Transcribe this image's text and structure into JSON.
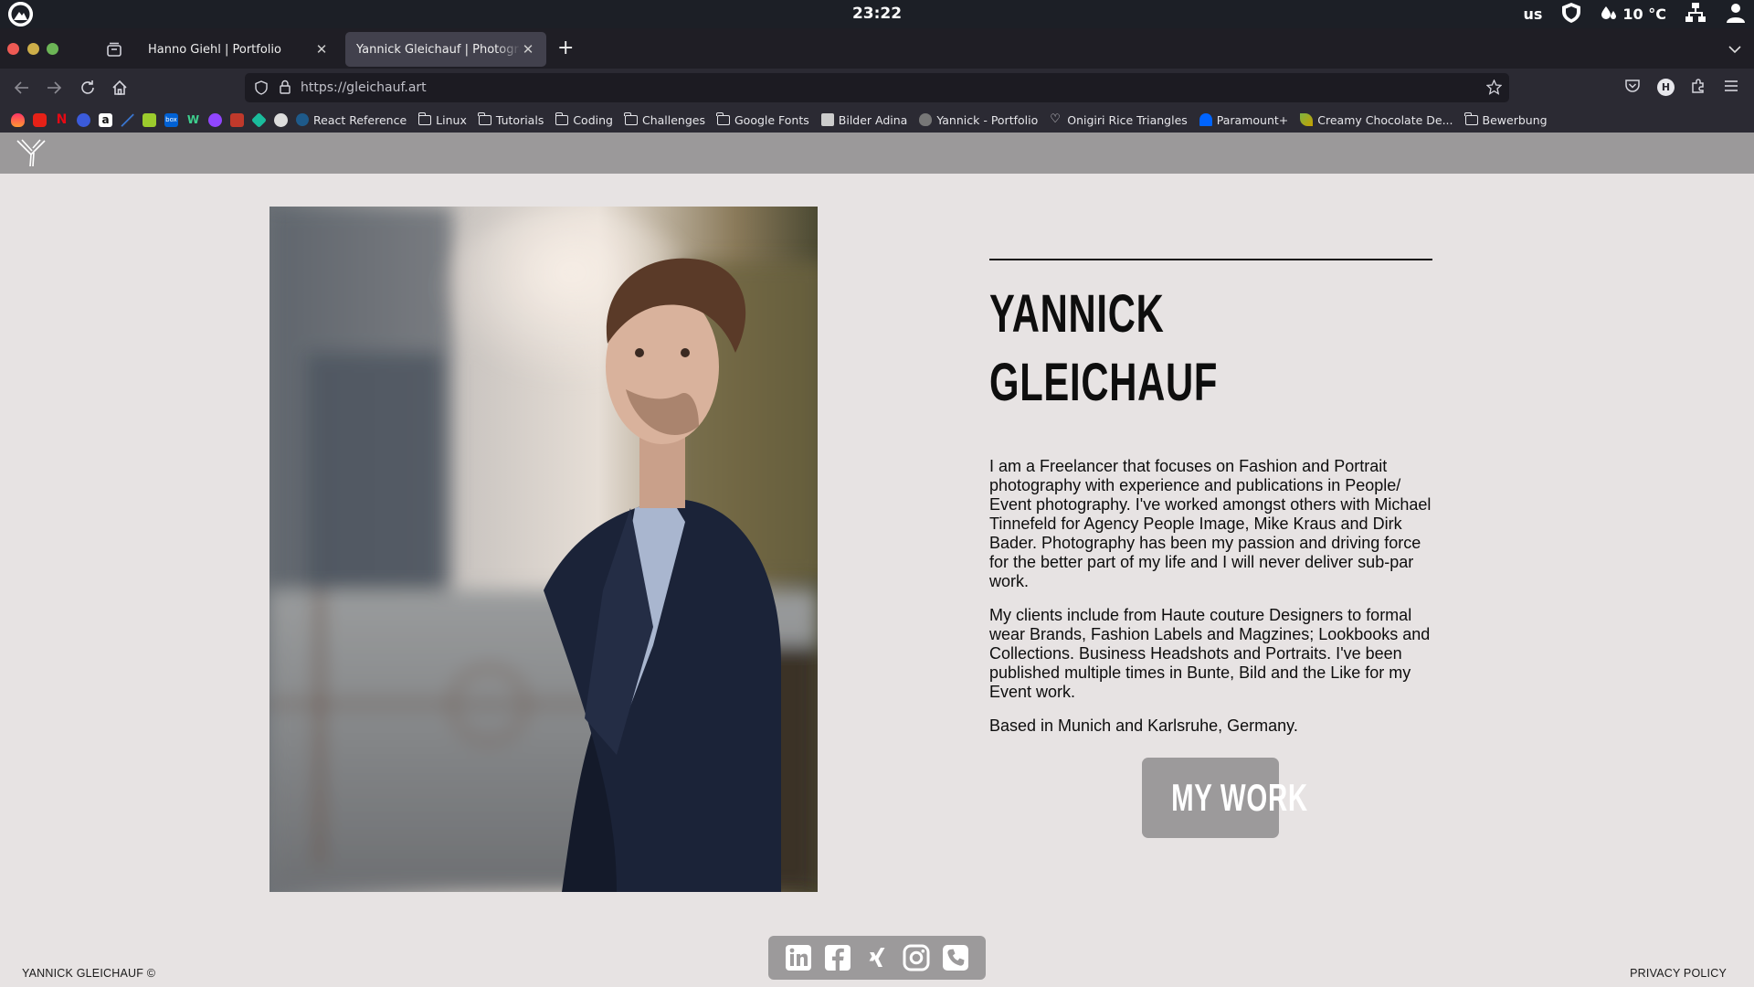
{
  "os": {
    "clock": "23:22",
    "keyboard_layout": "us",
    "weather": "10 °C",
    "icons": [
      "distro-logo-icon",
      "shield-icon",
      "weather-drops-icon",
      "network-icon",
      "user-icon"
    ]
  },
  "browser": {
    "tabs": [
      {
        "label": "Hanno Giehl | Portfolio",
        "active": false
      },
      {
        "label": "Yannick Gleichauf | Photography",
        "active": true
      }
    ],
    "url": "https://gleichauf.art",
    "bookmarks": [
      {
        "label": "React Reference",
        "icon": "globe-icon"
      },
      {
        "label": "Linux",
        "icon": "folder-icon"
      },
      {
        "label": "Tutorials",
        "icon": "folder-icon"
      },
      {
        "label": "Coding",
        "icon": "folder-icon"
      },
      {
        "label": "Challenges",
        "icon": "folder-icon"
      },
      {
        "label": "Google Fonts",
        "icon": "folder-icon"
      },
      {
        "label": "Bilder Adina",
        "icon": "image-icon"
      },
      {
        "label": "Yannick - Portfolio",
        "icon": "apple-icon"
      },
      {
        "label": "Onigiri Rice Triangles",
        "icon": "heart-icon"
      },
      {
        "label": "Paramount+",
        "icon": "paramount-icon"
      },
      {
        "label": "Creamy Chocolate De...",
        "icon": "leaf-icon"
      },
      {
        "label": "Bewerbung",
        "icon": "folder-icon"
      }
    ]
  },
  "site": {
    "name_line1": "YANNICK",
    "name_line2": "GLEICHAUF",
    "paragraphs": [
      "I am a Freelancer that focuses on Fashion and Portrait photography with experience and publications in People/ Event photography. I've worked amongst others with Michael Tinnefeld for Agency People Image, Mike Kraus and Dirk Bader. Photography has been my passion and driving force for the better part of my life and I will never deliver sub-par work.",
      "My clients include from Haute couture Designers to formal wear Brands, Fashion Labels and Magzines; Lookbooks and Collections. Business Headshots and Portraits. I've been published multiple times in Bunte, Bild and the Like for my Event work.",
      "Based in Munich and Karlsruhe, Germany."
    ],
    "cta_label": "MY WORK",
    "social_icons": [
      "linkedin-icon",
      "facebook-icon",
      "xing-icon",
      "instagram-icon",
      "phone-icon"
    ],
    "footer_copyright": "YANNICK GLEICHAUF ©",
    "footer_privacy": "PRIVACY POLICY",
    "colors": {
      "page_bg": "#e7e3e3",
      "header_bg": "#9b999a",
      "button_bg": "#9c9a9b",
      "text": "#111111"
    }
  }
}
